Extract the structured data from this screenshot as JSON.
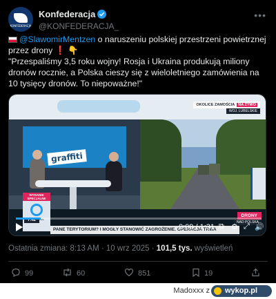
{
  "post": {
    "author_name": "Konfederacja",
    "handle": "@KONFEDERACJA_",
    "avatar_text": "KONFEDERACJA",
    "mention": "@SlawomirMentzen",
    "line1_rest": " o naruszeniu polskiej przestrzeni powietrznej przez drony",
    "quote": "\"Przespaliśmy 3,5 roku wojny! Rosja i Ukraina produkują miliony dronów rocznie, a Polska cieszy się z wieloletniego zamówienia na 10 tysięcy dronów. To niepoważne!\"",
    "exclamation": "❗",
    "pointing": "👇"
  },
  "video": {
    "top_label": "OKOLICE ZAMOŚCIA",
    "live_badge": "NA ŻYWO",
    "top_sublabel": "WOJ. LUBELSKIE",
    "studio_sign": "graffiti",
    "tag_top": "WYDANIE SPECJALNE",
    "tag_brand": "polsat news",
    "clock": "7:42",
    "ticker": "PANE TERYTORIUM? I MOGŁY STANOWIĆ ZAGROŻENIE. OPERACJA TRWA",
    "side_label": "DRONY",
    "side_sublabel": "NAD POLSKĄ",
    "time_display": "0:09 / 1:31",
    "progress_fraction": 0.1
  },
  "meta": {
    "edited": "Ostatnia zmiana: 8:13 AM · 10 wrz 2025 · ",
    "views": "101,5 tys.",
    "views_label": " wyświetleń"
  },
  "actions": {
    "replies": "99",
    "reposts": "60",
    "likes": "851",
    "bookmarks": "19"
  },
  "footer": {
    "author": "Madoxxx  z",
    "site": "wykop.pl"
  },
  "colors": {
    "accent": "#1d9bf0",
    "background": "#000000"
  }
}
